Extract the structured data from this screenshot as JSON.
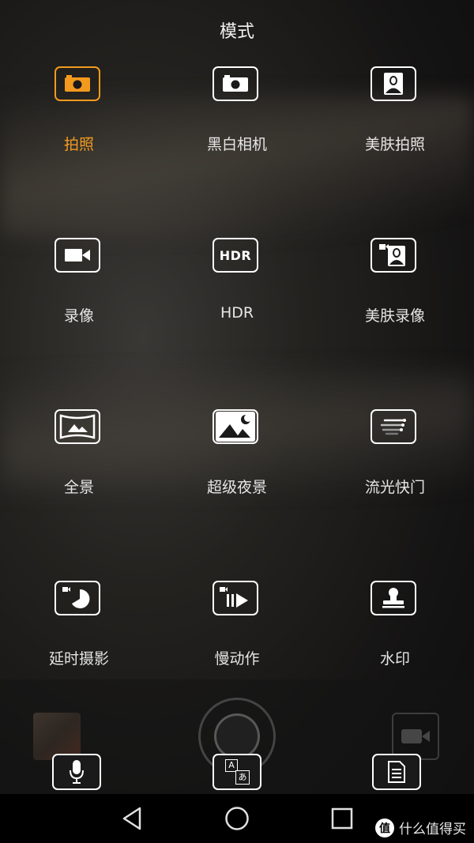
{
  "header": {
    "title": "模式"
  },
  "modes": [
    {
      "label": "拍照",
      "icon": "camera-icon",
      "active": true
    },
    {
      "label": "黑白相机",
      "icon": "bw-camera-icon",
      "active": false
    },
    {
      "label": "美肤拍照",
      "icon": "beauty-portrait-icon",
      "active": false
    },
    {
      "label": "录像",
      "icon": "video-icon",
      "active": false
    },
    {
      "label": "HDR",
      "icon": "hdr-icon",
      "icon_text": "HDR",
      "active": false
    },
    {
      "label": "美肤录像",
      "icon": "beauty-video-icon",
      "active": false
    },
    {
      "label": "全景",
      "icon": "panorama-icon",
      "active": false
    },
    {
      "label": "超级夜景",
      "icon": "night-scene-icon",
      "active": false
    },
    {
      "label": "流光快门",
      "icon": "light-painting-icon",
      "active": false
    },
    {
      "label": "延时摄影",
      "icon": "timelapse-icon",
      "active": false
    },
    {
      "label": "慢动作",
      "icon": "slow-motion-icon",
      "active": false
    },
    {
      "label": "水印",
      "icon": "watermark-stamp-icon",
      "active": false
    }
  ],
  "bottom_tools": [
    {
      "icon": "microphone-icon"
    },
    {
      "icon": "translate-icon",
      "glyph_top": "A",
      "glyph_bottom": "あ"
    },
    {
      "icon": "document-icon"
    }
  ],
  "navigation": {
    "back": "back-icon",
    "home": "home-icon",
    "recents": "recents-icon"
  },
  "watermark": {
    "logo_char": "值",
    "text": "什么值得买"
  },
  "colors": {
    "accent": "#f39a1e",
    "text": "#ffffff"
  }
}
